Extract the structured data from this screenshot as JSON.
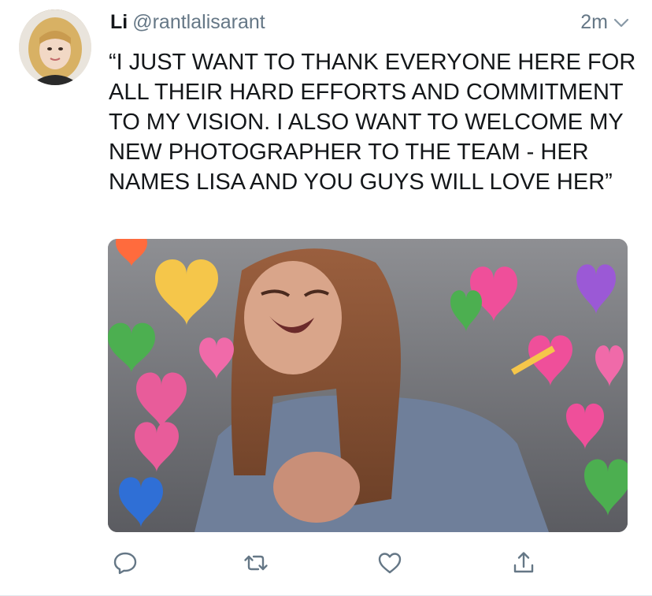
{
  "tweet": {
    "author_name": "Li",
    "author_handle": "@rantlalisarant",
    "timestamp": "2m",
    "text": "“I JUST WANT TO THANK EVERYONE HERE FOR ALL THEIR HARD EFFORTS AND COMMITMENT TO MY VISION. I ALSO WANT TO WELCOME MY NEW PHOTOGRAPHER TO THE TEAM - HER NAMES LISA AND YOU GUYS WILL LOVE HER”"
  },
  "icons": {
    "caret": "chevron-down-icon",
    "reply": "reply-icon",
    "retweet": "retweet-icon",
    "like": "heart-icon",
    "share": "share-icon"
  },
  "colors": {
    "text": "#14171a",
    "muted": "#657786",
    "icon": "#657786"
  }
}
